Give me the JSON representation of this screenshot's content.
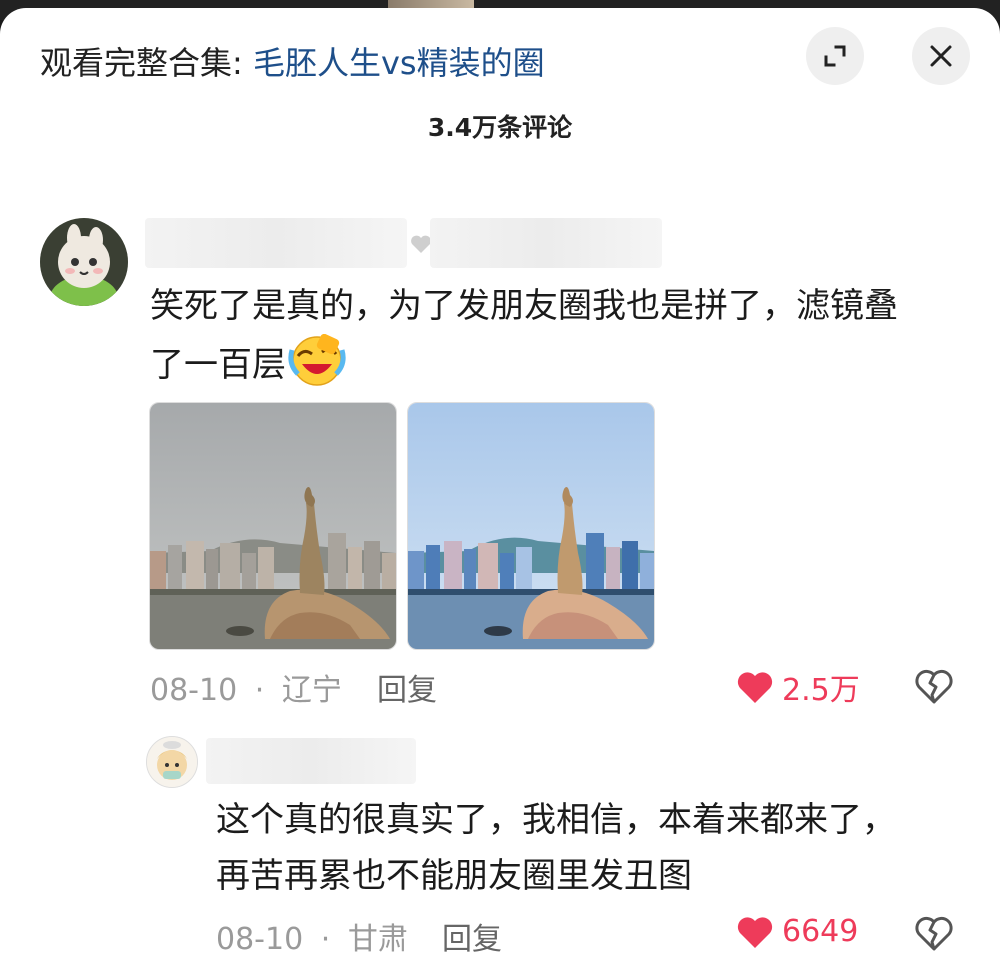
{
  "header": {
    "prefix": "观看完整合集: ",
    "collection_link": "毛胚人生vs精装的圈",
    "expand_icon": "expand-icon",
    "close_icon": "close-icon"
  },
  "comment_count": "3.4万条评论",
  "comments": [
    {
      "text_line1": "笑死了是真的，为了发朋友圈我也是拼了，滤镜叠",
      "text_line2": "了一百层",
      "emoji": "laughing-crying-emoji",
      "date": "08-10",
      "separator": "·",
      "location": "辽宁",
      "reply_label": "回复",
      "likes": "2.5万"
    },
    {
      "text_line1": "这个真的很真实了，我相信，本着来都来了，",
      "text_line2": "再苦再累也不能朋友圈里发丑图",
      "date": "08-10",
      "separator": "·",
      "location": "甘肃",
      "reply_label": "回复",
      "likes": "6649"
    }
  ],
  "colors": {
    "link": "#1e4f8a",
    "like": "#ee3b5a",
    "meta": "#9a9a9a"
  }
}
